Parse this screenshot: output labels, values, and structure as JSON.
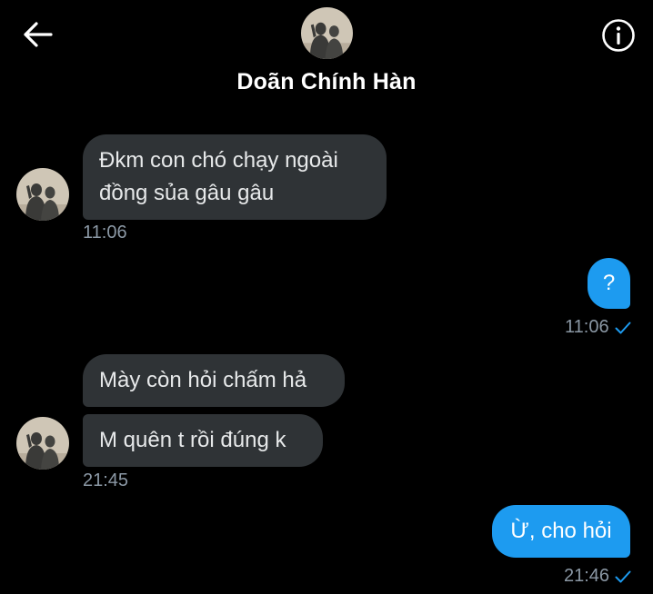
{
  "header": {
    "name": "Doãn Chính Hàn",
    "back_icon": "arrow-left-icon",
    "info_icon": "info-icon"
  },
  "colors": {
    "background": "#000000",
    "incoming_bubble": "#2f3336",
    "outgoing_bubble": "#1d9bf0",
    "timestamp": "#8b98a5",
    "read_check": "#1d9bf0"
  },
  "messages": [
    {
      "direction": "incoming",
      "lines": [
        "Đkm con chó chạy ngoài",
        "đồng sủa gâu gâu"
      ],
      "time": "11:06"
    },
    {
      "direction": "outgoing",
      "lines": [
        "?"
      ],
      "time": "11:06",
      "status_icon": "check-icon"
    },
    {
      "direction": "incoming",
      "lines": [
        "Mày còn hỏi chấm hả"
      ]
    },
    {
      "direction": "incoming",
      "lines": [
        "M quên t rồi đúng k"
      ],
      "time": "21:45"
    },
    {
      "direction": "outgoing",
      "lines": [
        "Ừ, cho hỏi"
      ],
      "time": "21:46",
      "status_icon": "check-icon"
    }
  ]
}
